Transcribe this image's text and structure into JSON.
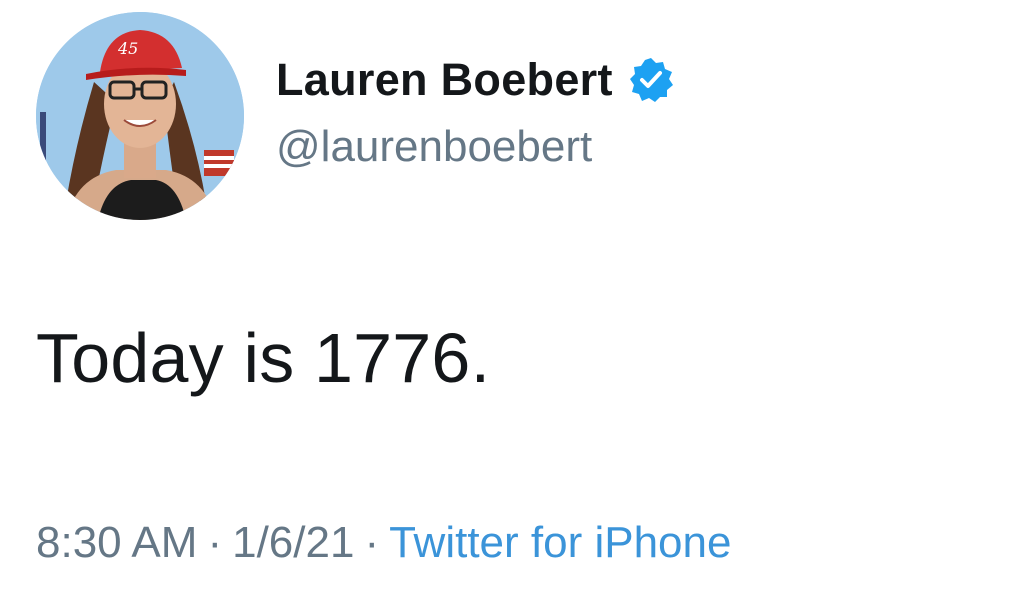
{
  "author": {
    "display_name": "Lauren Boebert",
    "handle": "@laurenboebert",
    "verified": true,
    "avatar_icon": "profile-photo-avatar",
    "avatar_hat_text": "45"
  },
  "tweet": {
    "text": "Today is 1776."
  },
  "meta": {
    "time": "8:30 AM",
    "date": "1/6/21",
    "separator": "·",
    "source": "Twitter for iPhone"
  },
  "colors": {
    "text_primary": "#14171a",
    "text_secondary": "#657786",
    "link": "#3b94d9",
    "verified_badge": "#1da1f2"
  }
}
